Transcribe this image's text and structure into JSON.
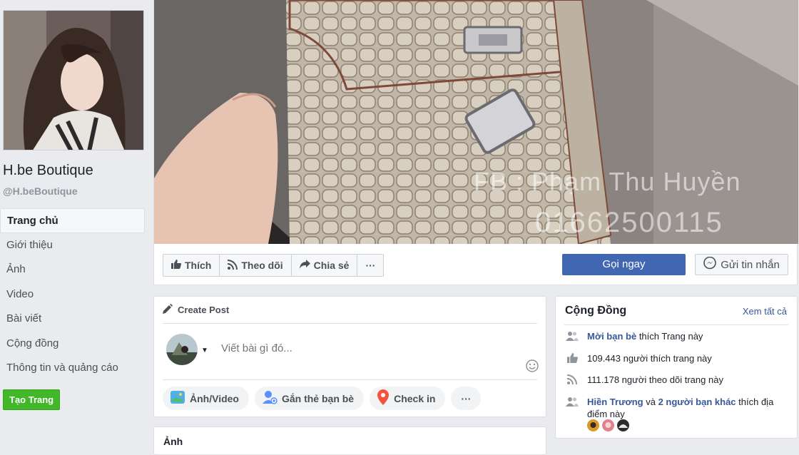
{
  "sidebar": {
    "page_name": "H.be Boutique",
    "page_handle": "@H.beBoutique",
    "nav": [
      {
        "label": "Trang chủ",
        "active": true
      },
      {
        "label": "Giới thiệu"
      },
      {
        "label": "Ảnh"
      },
      {
        "label": "Video"
      },
      {
        "label": "Bài viết"
      },
      {
        "label": "Cộng đồng"
      },
      {
        "label": "Thông tin và quảng cáo"
      }
    ],
    "create_page_label": "Tạo Trang"
  },
  "cover": {
    "watermark_line1": "FB : Phạm Thu Huyền",
    "watermark_line2": "01662500115"
  },
  "actions": {
    "like_label": "Thích",
    "follow_label": "Theo dõi",
    "share_label": "Chia sẻ",
    "more_label": "···",
    "call_label": "Gọi ngay",
    "message_label": "Gửi tin nhắn"
  },
  "create_post": {
    "header": "Create Post",
    "placeholder": "Viết bài gì đó...",
    "photo_video_label": "Ảnh/Video",
    "tag_friends_label": "Gắn thẻ bạn bè",
    "checkin_label": "Check in",
    "more_label": "···"
  },
  "photos_card": {
    "title": "Ảnh"
  },
  "community": {
    "title": "Cộng Đồng",
    "see_all": "Xem tất cả",
    "invite_link": "Mời bạn bè",
    "invite_rest": " thích Trang này",
    "likes_text": "109.443 người thích trang này",
    "follows_text": "111.178 người theo dõi trang này",
    "friend_name": "Hiền Trương",
    "friend_and": " và ",
    "friend_others": "2 người bạn khác",
    "friend_rest": " thích địa điểm này"
  },
  "colors": {
    "primary_blue": "#4267b2",
    "link_blue": "#365899",
    "green": "#42b72a",
    "background": "#e9ebee"
  }
}
